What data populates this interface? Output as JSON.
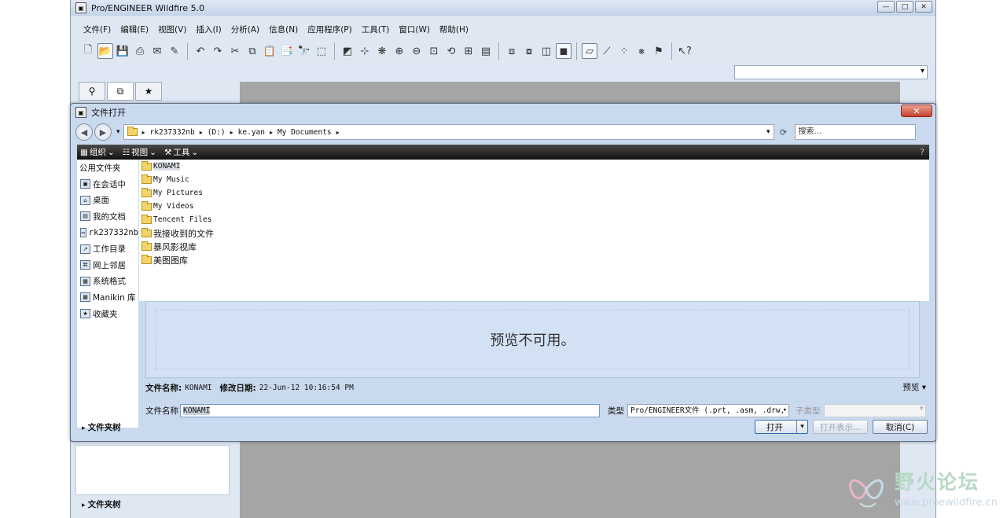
{
  "app": {
    "title": "Pro/ENGINEER Wildfire 5.0",
    "window_buttons": [
      "—",
      "□",
      "✕"
    ],
    "menu": [
      "文件(F)",
      "编辑(E)",
      "视图(V)",
      "插入(I)",
      "分析(A)",
      "信息(N)",
      "应用程序(P)",
      "工具(T)",
      "窗口(W)",
      "帮助(H)"
    ],
    "bottom_tree_label": "文件夹树"
  },
  "dialog": {
    "title": "文件打开",
    "close": "✕",
    "address": {
      "segments": [
        "rk237332nb",
        "(D:)",
        "ke.yan",
        "My Documents"
      ],
      "search_placeholder": "搜索..."
    },
    "commands": [
      "组织",
      "视图",
      "工具"
    ],
    "places": {
      "header": "公用文件夹",
      "items": [
        "在会话中",
        "桌面",
        "我的文档",
        "rk237332nb",
        "工作目录",
        "网上邻居",
        "系统格式",
        "Manikin 库",
        "收藏夹"
      ]
    },
    "files": [
      "KONAMI",
      "My Music",
      "My Pictures",
      "My Videos",
      "Tencent Files",
      "我接收到的文件",
      "暴风影视库",
      "美图图库"
    ],
    "selected_file": "KONAMI",
    "preview_text": "预览不可用。",
    "info": {
      "name_label": "文件名称:",
      "name_value": "KONAMI",
      "date_label": "修改日期:",
      "date_value": "22-Jun-12 10:16:54 PM"
    },
    "preview_toggle": "预览",
    "filename_label": "文件名称",
    "filename_value": "KONAMI",
    "type_label": "类型",
    "type_value": "Pro/ENGINEER文件 (.prt, .asm, .drw, .",
    "subtype_label": "子类型",
    "folder_tree_label": "文件夹树",
    "buttons": {
      "open": "打开",
      "open_rep": "打开表示...",
      "cancel": "取消(C)"
    }
  },
  "watermark": {
    "title": "野火论坛",
    "url": "www.proewildfire.cn"
  }
}
